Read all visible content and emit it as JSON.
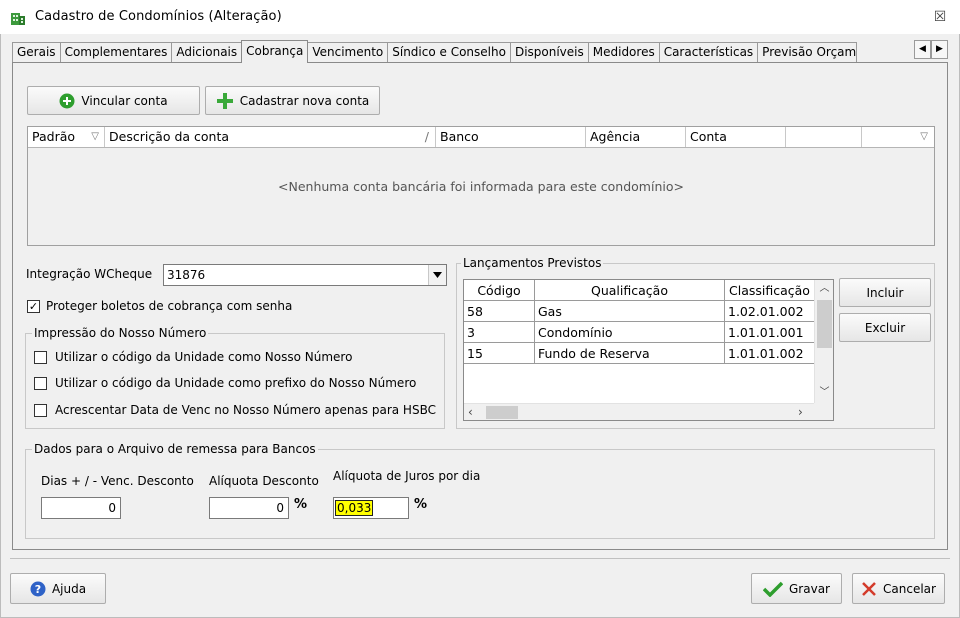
{
  "window": {
    "title": "Cadastro de Condomínios (Alteração)",
    "close_glyph": "☒"
  },
  "tabs": [
    {
      "label": "Gerais"
    },
    {
      "label": "Complementares"
    },
    {
      "label": "Adicionais"
    },
    {
      "label": "Cobrança",
      "active": true
    },
    {
      "label": "Vencimento"
    },
    {
      "label": "Síndico e Conselho"
    },
    {
      "label": "Disponíveis"
    },
    {
      "label": "Medidores"
    },
    {
      "label": "Características"
    },
    {
      "label": "Previsão Orçam"
    }
  ],
  "tab_scroll": {
    "left": "◀",
    "right": "▶"
  },
  "accounts": {
    "link_button": "Vincular conta",
    "new_button": "Cadastrar nova conta",
    "columns": [
      "Padrão",
      "Descrição da conta",
      "Banco",
      "Agência",
      "Conta"
    ],
    "empty_message": "<Nenhuma conta bancária foi informada para este condomínio>"
  },
  "integration": {
    "label": "Integração WCheque",
    "value": "31876"
  },
  "protect": {
    "label": "Proteger boletos de cobrança com senha",
    "checked": true
  },
  "nosso_numero": {
    "title": "Impressão do Nosso Número",
    "options": [
      {
        "label": "Utilizar o código da Unidade como Nosso Número",
        "checked": false
      },
      {
        "label": "Utilizar o código da Unidade como prefixo do Nosso Número",
        "checked": false
      },
      {
        "label": "Acrescentar Data de Venc no Nosso Número apenas para HSBC",
        "checked": false
      }
    ]
  },
  "lancamentos": {
    "title": "Lançamentos Previstos",
    "columns": [
      "Código",
      "Qualificação",
      "Classificação"
    ],
    "rows": [
      {
        "codigo": "58",
        "qualificacao": "Gas",
        "classificacao": "1.02.01.002"
      },
      {
        "codigo": "3",
        "qualificacao": "Condomínio",
        "classificacao": "1.01.01.001"
      },
      {
        "codigo": "15",
        "qualificacao": "Fundo  de Reserva",
        "classificacao": "1.01.01.002"
      }
    ],
    "include_button": "Incluir",
    "exclude_button": "Excluir"
  },
  "remessa": {
    "title": "Dados para o Arquivo de remessa para Bancos",
    "dias_label": "Dias + / - Venc. Desconto",
    "dias_value": "0",
    "aliquota_desc_label": "Alíquota Desconto",
    "aliquota_desc_value": "0",
    "aliquota_juros_label": "Alíquota de Juros por dia",
    "aliquota_juros_value": "0,033",
    "percent": "%"
  },
  "footer": {
    "help_button": "Ajuda",
    "save_button": "Gravar",
    "cancel_button": "Cancelar"
  },
  "colors": {
    "highlight": "#ffff00",
    "add_green": "#2e9e2e",
    "cancel_red": "#d33b2b",
    "help_blue": "#2e62c7"
  }
}
